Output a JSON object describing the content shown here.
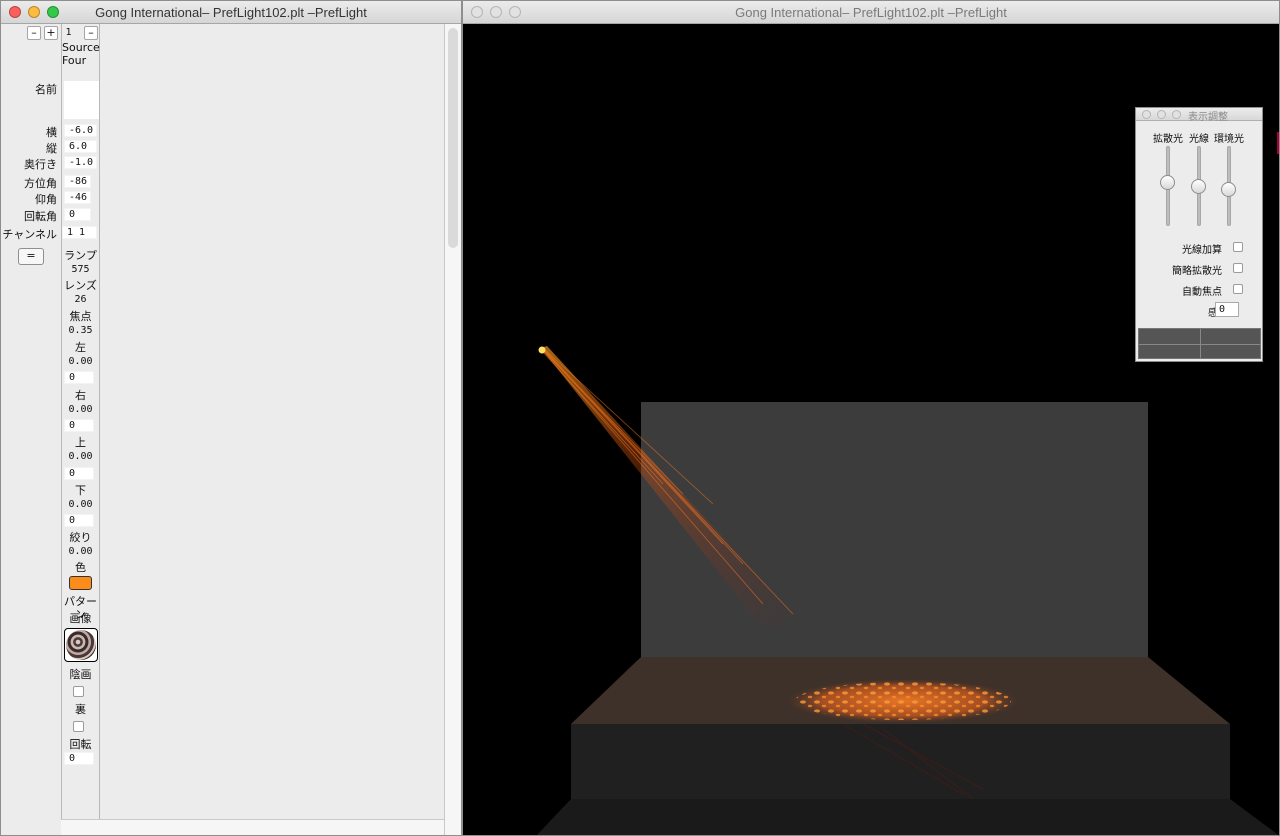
{
  "windows": {
    "left_title": "Gong International– PrefLight102.plt –PrefLight",
    "right_title": "Gong International– PrefLight102.plt –PrefLight"
  },
  "fixture": {
    "minus": "–",
    "plus": "+",
    "number": "1",
    "minus2": "–",
    "type_line1": "Source",
    "type_line2": "Four"
  },
  "labels": {
    "name": "名前",
    "x": "横",
    "y": "縦",
    "depth": "奥行き",
    "azimuth": "方位角",
    "elevation": "仰角",
    "rotation": "回転角",
    "channel": "チャンネル",
    "eq_button": "="
  },
  "values": {
    "name": "",
    "x": "-6.0",
    "y": "6.0",
    "depth": "-1.0",
    "azimuth": "-86",
    "elevation": "-46",
    "rotation": "0",
    "channel": "1 1"
  },
  "params": {
    "lamp_label": "ランプ",
    "lamp_value": "575",
    "lens_label": "レンズ",
    "lens_value": "26",
    "focus_label": "焦点",
    "focus_value": "0.35",
    "left_label": "左",
    "left_value": "0.00",
    "left_field": "0",
    "right_label": "右",
    "right_value": "0.00",
    "right_field": "0",
    "top_label": "上",
    "top_value": "0.00",
    "top_field": "0",
    "bottom_label": "下",
    "bottom_value": "0.00",
    "bottom_field": "0",
    "iris_label": "絞り",
    "iris_value": "0.00",
    "color_label": "色",
    "color_hex": "#f98c1a",
    "pattern_label": "パターン",
    "image_label": "画像",
    "shade_label": "陰画",
    "back_label": "裏",
    "rot_label": "回転",
    "rot_value": "0"
  },
  "panel": {
    "title": "表示調整",
    "col1": "拡散光",
    "col2": "光線",
    "col3": "環境光",
    "slider1": 0.45,
    "slider2": 0.5,
    "slider3": 0.55,
    "chk1": "光線加算",
    "chk2": "簡略拡散光",
    "chk3": "自動焦点",
    "sens_label": "感度",
    "sens_value": "0"
  }
}
